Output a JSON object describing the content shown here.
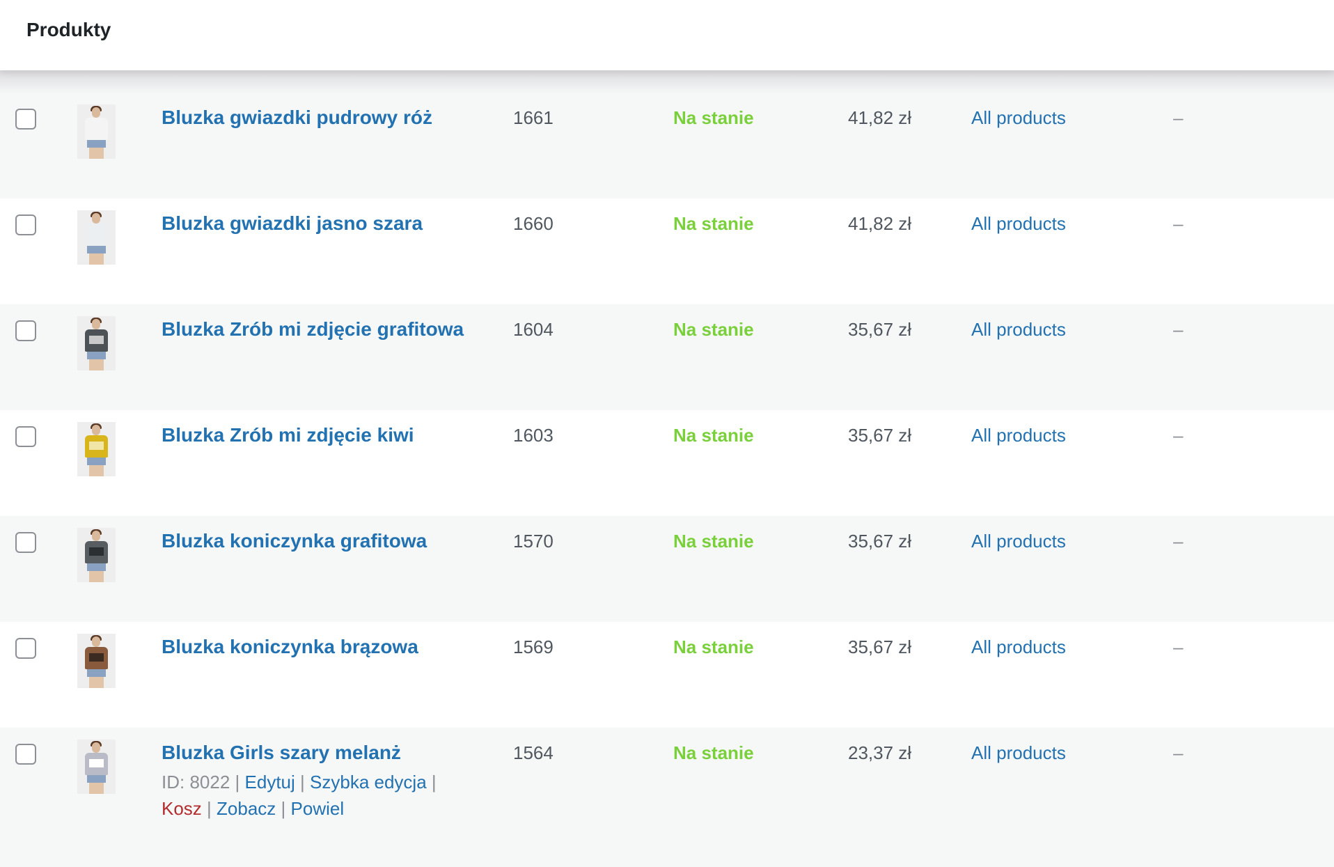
{
  "page": {
    "title": "Produkty"
  },
  "colors": {
    "link": "#2271b1",
    "in_stock": "#7ad03a",
    "trash": "#b32d2e",
    "row_alt": "#f6f7f7"
  },
  "products": [
    {
      "name": "Bluzka gwiazdki pudrowy róż",
      "sku": "1661",
      "stock": "Na stanie",
      "price": "41,82 zł",
      "category": "All products",
      "tags": "–",
      "shirt_color": "#f4f4f4",
      "print_color": "#f4f4f4"
    },
    {
      "name": "Bluzka gwiazdki jasno szara",
      "sku": "1660",
      "stock": "Na stanie",
      "price": "41,82 zł",
      "category": "All products",
      "tags": "–",
      "shirt_color": "#eceff2",
      "print_color": "#eceff2"
    },
    {
      "name": "Bluzka Zrób mi zdjęcie grafitowa",
      "sku": "1604",
      "stock": "Na stanie",
      "price": "35,67 zł",
      "category": "All products",
      "tags": "–",
      "shirt_color": "#4c5255",
      "print_color": "#c9c9c9"
    },
    {
      "name": "Bluzka Zrób mi zdjęcie kiwi",
      "sku": "1603",
      "stock": "Na stanie",
      "price": "35,67 zł",
      "category": "All products",
      "tags": "–",
      "shirt_color": "#d9b51c",
      "print_color": "#f1e6a8"
    },
    {
      "name": "Bluzka koniczynka grafitowa",
      "sku": "1570",
      "stock": "Na stanie",
      "price": "35,67 zł",
      "category": "All products",
      "tags": "–",
      "shirt_color": "#575d60",
      "print_color": "#2c2f31"
    },
    {
      "name": "Bluzka koniczynka brązowa",
      "sku": "1569",
      "stock": "Na stanie",
      "price": "35,67 zł",
      "category": "All products",
      "tags": "–",
      "shirt_color": "#8a5a3c",
      "print_color": "#3b2a1f"
    },
    {
      "name": "Bluzka Girls szary melanż",
      "sku": "1564",
      "stock": "Na stanie",
      "price": "23,37 zł",
      "category": "All products",
      "tags": "–",
      "shirt_color": "#b9bcc6",
      "print_color": "#ffffff"
    }
  ],
  "row_actions": {
    "id_text": "ID: 8022",
    "separator": "|",
    "edit": "Edytuj",
    "quick_edit": "Szybka edycja",
    "trash": "Kosz",
    "view": "Zobacz",
    "duplicate": "Powiel"
  }
}
